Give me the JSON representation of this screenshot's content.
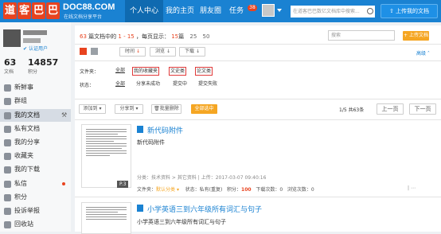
{
  "header": {
    "logo_chars": [
      "道",
      "客",
      "巴",
      "巴"
    ],
    "logo_en": "DOC88.COM",
    "logo_sub": "在线文档分享平台",
    "nav": [
      {
        "label": "个人中心",
        "active": true
      },
      {
        "label": "我的主页",
        "active": false
      },
      {
        "label": "朋友圈",
        "active": false
      },
      {
        "label": "任务",
        "active": false
      }
    ],
    "task_badge": "38",
    "search_placeholder": "在道客巴巴数亿文档库中搜索...",
    "upload_label": "上传我的文档"
  },
  "sidebar": {
    "verify_label": "认证用户",
    "stats": [
      {
        "value": "63",
        "label": "文档"
      },
      {
        "value": "14857",
        "label": "积分"
      }
    ],
    "items": [
      {
        "label": "新鲜事",
        "active": false
      },
      {
        "label": "群组",
        "active": false
      },
      {
        "label": "我的文档",
        "active": true
      },
      {
        "label": "私有文档",
        "active": false
      },
      {
        "label": "我的分享",
        "active": false
      },
      {
        "label": "收藏夹",
        "active": false
      },
      {
        "label": "我的下载",
        "active": false
      },
      {
        "label": "私信",
        "active": false,
        "dot": true
      },
      {
        "label": "积分",
        "active": false
      },
      {
        "label": "投诉举报",
        "active": false
      },
      {
        "label": "回收站",
        "active": false
      }
    ]
  },
  "main": {
    "summary": {
      "count": "63",
      "text1": "篇文档中的",
      "range": "1 - 15",
      "text2": "，每页显示：",
      "per_page": "15",
      "unit": "篇",
      "opt25": "25",
      "opt50": "50"
    },
    "search_placeholder": "搜索",
    "upload_label": "+ 上传文档",
    "sort": {
      "time": "时间",
      "browse": "浏览",
      "download": "下载"
    },
    "advanced": "高级",
    "filter": {
      "folder_label": "文件夹：",
      "all": "全部",
      "folders": [
        "我的收藏夹",
        "文史类",
        "论文类"
      ],
      "status_label": "状态：",
      "status_all": "全部",
      "statuses": [
        "分享未成功",
        "提交中",
        "提交失败"
      ]
    },
    "toolbar": {
      "add_to": "添加到",
      "share_to": "分享到",
      "batch_delete": "批量删除",
      "select_all": "全部选中",
      "page_info": "1/5 共63条",
      "prev": "上一页",
      "next": "下一页"
    },
    "docs": [
      {
        "title": "新代码附件",
        "desc": "新代码附件",
        "pages": "P.3",
        "category": "分类：技术资料 > 其它资料",
        "upload": "上传：2017-03-07 09:40:16",
        "folder_label": "文件夹：",
        "folder": "默认分类",
        "status_label": "状态：",
        "status": "私有(重复)",
        "points_label": "积分：",
        "points": "100",
        "downloads_label": "下载次数：",
        "downloads": "0",
        "views_label": "浏览次数：",
        "views": "0"
      },
      {
        "title": "小学英语三到六年级所有词汇与句子",
        "desc": "小学英语三到六年级所有词汇与句子"
      }
    ]
  }
}
